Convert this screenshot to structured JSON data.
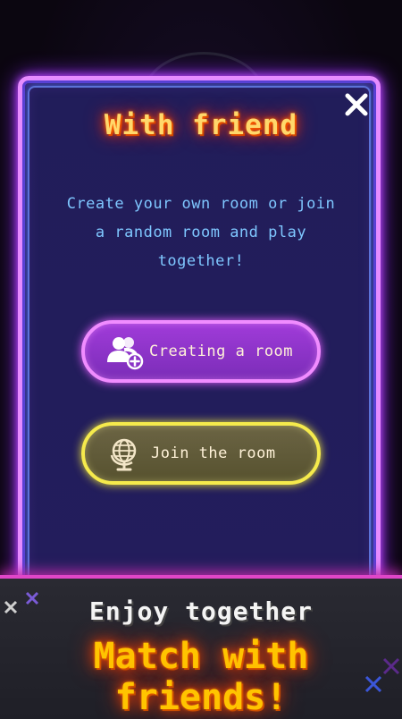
{
  "dialog": {
    "title": "With friend",
    "description": "Create your own room or join a random room and play together!",
    "close_icon": "close-icon"
  },
  "buttons": {
    "create": {
      "label": "Creating a room",
      "icon": "add-user-icon"
    },
    "join": {
      "label": "Join the room",
      "icon": "globe-icon"
    }
  },
  "banner": {
    "subtitle": "Enjoy together",
    "headline": "Match with friends!"
  },
  "colors": {
    "dialog_bg": "#211d5a",
    "dialog_border": "#e78cff",
    "title": "#ffd86b",
    "description": "#7fc7ff",
    "create_button": "#8a33c7",
    "join_button": "#5f5a39",
    "headline": "#ffc400"
  }
}
